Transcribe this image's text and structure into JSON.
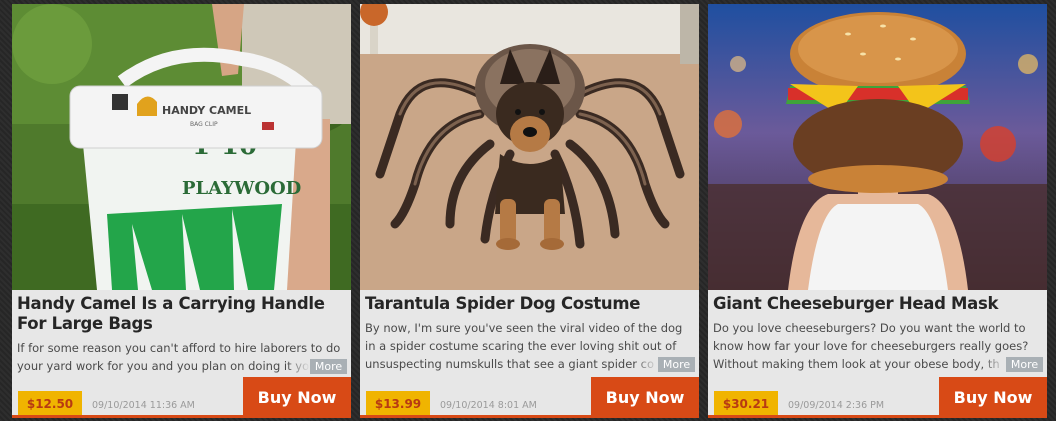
{
  "products": [
    {
      "title": "Handy Camel Is a Carrying Handle For Large Bags",
      "description": "If for some reason you can't afford to hire laborers to do your yard work for you and you plan on doing it yo",
      "more_label": "More",
      "price": "$12.50",
      "date": "09/10/2014 11:36 AM",
      "buy_label": "Buy Now",
      "image_text": {
        "brand": "HANDY CAMEL",
        "brand_sub": "BAG CLIP",
        "bag_text_1": "1-10",
        "bag_text_2": "PLAYWOOD"
      }
    },
    {
      "title": "Tarantula Spider Dog Costume",
      "description": "By now, I'm sure you've seen the viral video of the dog in a spider costume scaring the ever loving shit out of unsuspecting numskulls that see a giant spider co",
      "more_label": "More",
      "price": "$13.99",
      "date": "09/10/2014 8:01 AM",
      "buy_label": "Buy Now"
    },
    {
      "title": "Giant Cheeseburger Head Mask",
      "description": "Do you love cheeseburgers? Do you want the world to know how far your love for cheeseburgers really goes? Without making them look at your obese body, th",
      "more_label": "More",
      "price": "$30.21",
      "date": "09/09/2014 2:36 PM",
      "buy_label": "Buy Now"
    }
  ],
  "colors": {
    "buy_button": "#d84a16",
    "price_badge": "#f0b400",
    "card_bg": "#e7e7e7",
    "page_bg": "#2b2b2b",
    "more_button": "#a9b0b5"
  }
}
